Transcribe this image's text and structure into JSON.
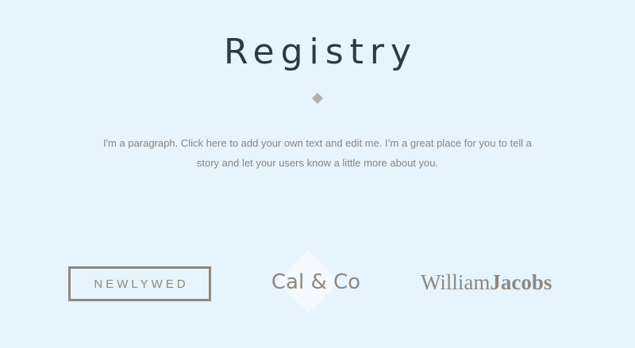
{
  "header": {
    "title": "Registry"
  },
  "intro": {
    "paragraph": "I'm a paragraph. Click here to add your own text and edit me. I’m a great place for you to tell a story and let your users know a little more about you."
  },
  "logos": {
    "newlywed": "NEWLYWED",
    "cal_and_co": "Cal & Co",
    "william_first": "William",
    "william_second": "Jacobs"
  },
  "colors": {
    "background": "#e6f4fd",
    "title": "#2c3a47",
    "body_text": "#8a8580",
    "logo_gray": "#8f8880",
    "divider": "#b5b1aa"
  }
}
